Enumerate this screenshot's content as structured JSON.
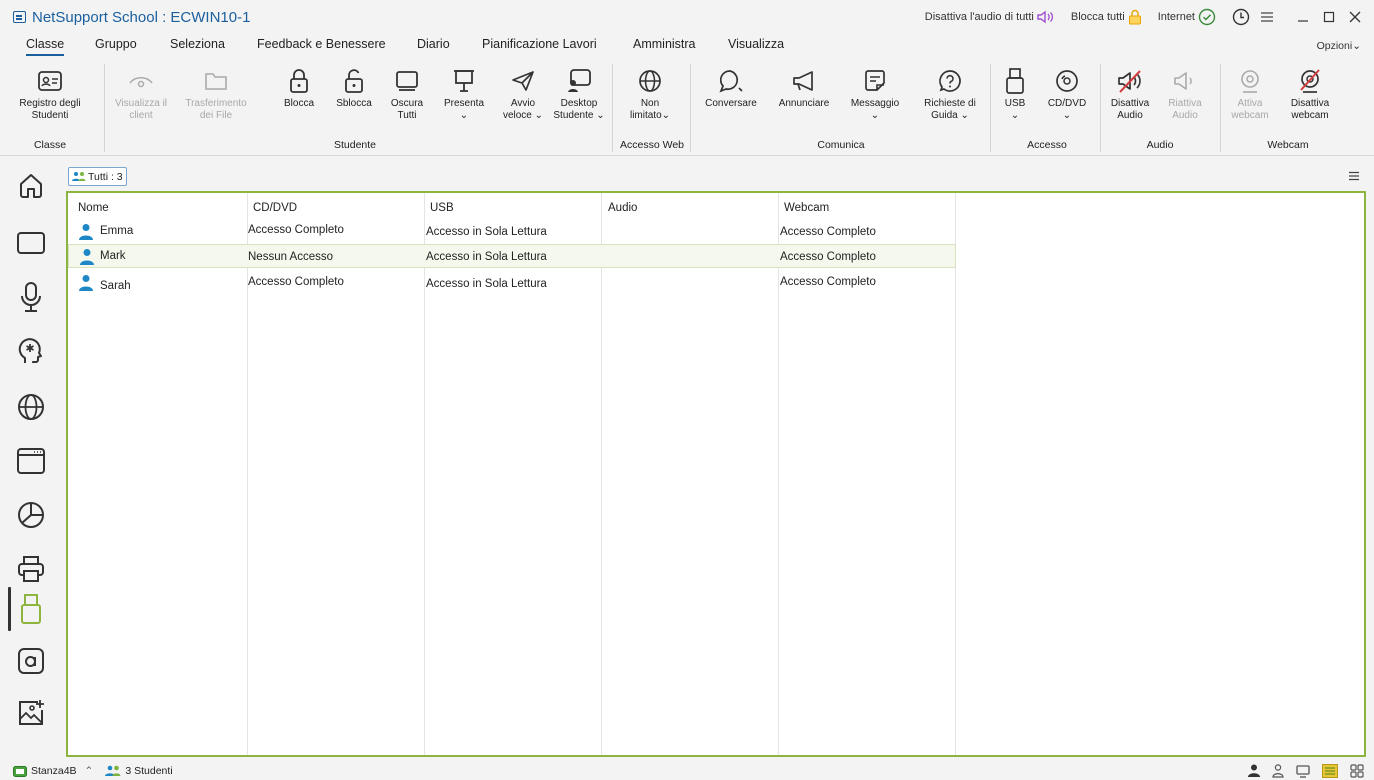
{
  "window": {
    "title": "NetSupport School : ECWIN10-1",
    "mute_all": "Disattiva l'audio di tutti",
    "lock_all": "Blocca tutti",
    "internet": "Internet"
  },
  "menu": {
    "items": [
      "Classe",
      "Gruppo",
      "Seleziona",
      "Feedback e Benessere",
      "Diario",
      "Pianificazione Lavori",
      "Amministra",
      "Visualizza"
    ],
    "options": "Opzioni"
  },
  "ribbon": {
    "buttons": [
      {
        "label": "Registro degli\nStudenti"
      },
      {
        "label": "Visualizza il\nclient"
      },
      {
        "label": "Trasferimento\ndei File"
      },
      {
        "label": "Blocca"
      },
      {
        "label": "Sblocca"
      },
      {
        "label": "Oscura\nTutti"
      },
      {
        "label": "Presenta\n⌄"
      },
      {
        "label": "Avvio\nveloce ⌄"
      },
      {
        "label": "Desktop\nStudente ⌄"
      },
      {
        "label": "Non\nlimitato⌄"
      },
      {
        "label": "Conversare"
      },
      {
        "label": "Annunciare"
      },
      {
        "label": "Messaggio\n⌄"
      },
      {
        "label": "Richieste di\nGuida ⌄"
      },
      {
        "label": "USB\n⌄"
      },
      {
        "label": "CD/DVD\n⌄"
      },
      {
        "label": "Disattiva\nAudio"
      },
      {
        "label": "Riattiva\nAudio"
      },
      {
        "label": "Attiva\nwebcam"
      },
      {
        "label": "Disattiva\nwebcam"
      }
    ],
    "groups": [
      "Classe",
      "Studente",
      "Accesso Web",
      "Comunica",
      "Accesso",
      "Audio",
      "Webcam"
    ]
  },
  "tab": {
    "label": "Tutti : 3"
  },
  "table": {
    "headers": [
      "Nome",
      "CD/DVD",
      "USB",
      "Audio",
      "Webcam"
    ],
    "rows": [
      {
        "name": "Emma",
        "cddvd": "Accesso Completo",
        "usb": "Accesso in Sola Lettura",
        "audio": "",
        "webcam": "Accesso Completo"
      },
      {
        "name": "Mark",
        "cddvd": "Nessun Accesso",
        "usb": "Accesso in Sola Lettura",
        "audio": "",
        "webcam": "Accesso Completo"
      },
      {
        "name": "Sarah",
        "cddvd": "Accesso Completo",
        "usb": "Accesso in Sola Lettura",
        "audio": "",
        "webcam": "Accesso Completo"
      }
    ]
  },
  "status": {
    "room": "Stanza4B",
    "students": "3 Studenti"
  },
  "colors": {
    "accent": "#1a5f9e",
    "frame": "#8db43f",
    "mute_icon": "#a24fd1",
    "lock_icon": "#e8a400",
    "ok_icon": "#3a8a3a"
  },
  "icons": {
    "sidebar": [
      "home-icon",
      "screen-icon",
      "microphone-icon",
      "head-asterisk-icon",
      "globe-icon",
      "browser-window-icon",
      "pie-chart-icon",
      "printer-icon",
      "usb-icon",
      "at-sign-icon",
      "image-add-icon"
    ]
  }
}
